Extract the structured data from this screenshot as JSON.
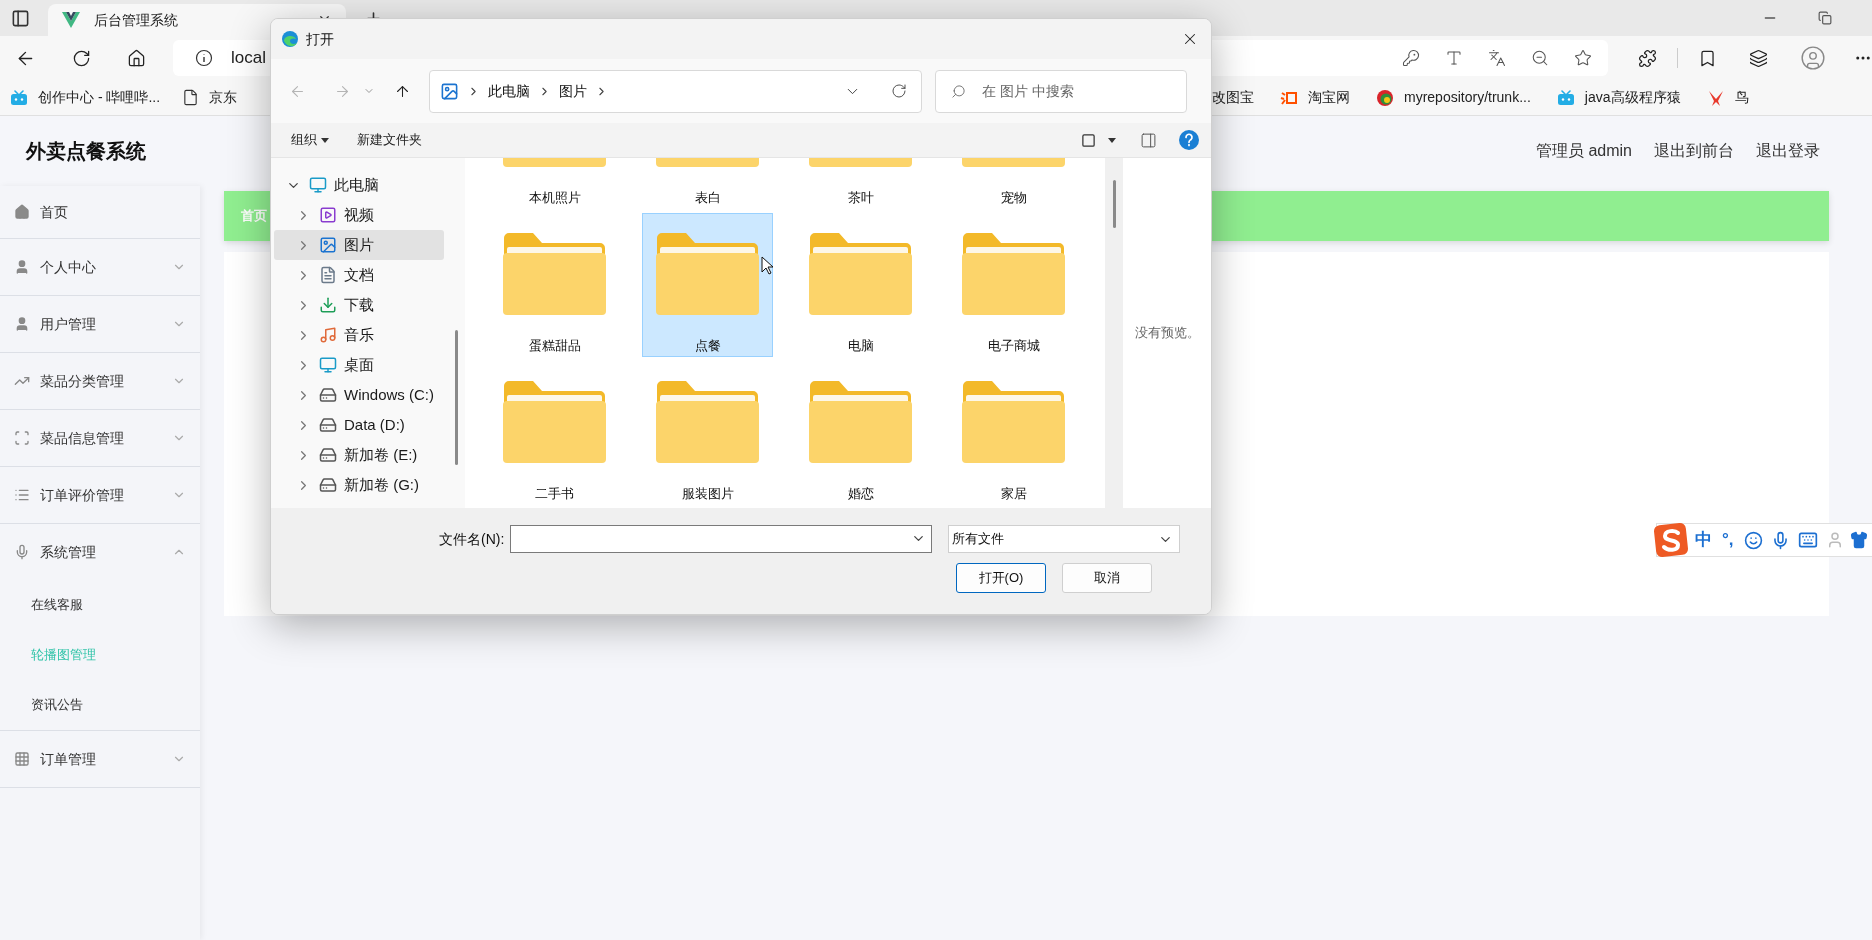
{
  "browser": {
    "tab": {
      "title": "后台管理系统"
    },
    "address": "local",
    "bookmarks_left": [
      {
        "label": "创作中心 - 哔哩哔..."
      },
      {
        "label": "京东"
      }
    ],
    "bookmarks_right": [
      {
        "label": "改图宝"
      },
      {
        "label": "淘宝网"
      },
      {
        "label": "myrepository/trunk..."
      },
      {
        "label": "java高级程序猿"
      },
      {
        "label": "鸟"
      }
    ]
  },
  "app": {
    "title": "外卖点餐系统",
    "header_links": [
      "管理员 admin",
      "退出到前台",
      "退出登录"
    ],
    "breadcrumb": "首页",
    "menu": [
      {
        "label": "首页"
      },
      {
        "label": "个人中心",
        "expanded": false
      },
      {
        "label": "用户管理",
        "expanded": false
      },
      {
        "label": "菜品分类管理",
        "expanded": false
      },
      {
        "label": "菜品信息管理",
        "expanded": false
      },
      {
        "label": "订单评价管理",
        "expanded": false
      },
      {
        "label": "系统管理",
        "expanded": true,
        "children": [
          {
            "label": "在线客服",
            "selected": false
          },
          {
            "label": "轮播图管理",
            "selected": true
          },
          {
            "label": "资讯公告",
            "selected": false
          }
        ]
      },
      {
        "label": "订单管理",
        "expanded": false
      }
    ]
  },
  "dialog": {
    "title": "打开",
    "nav": {
      "back": {
        "disabled": true
      },
      "forward": {
        "disabled": true
      },
      "up": {
        "disabled": false
      }
    },
    "path": [
      "此电脑",
      "图片"
    ],
    "search": {
      "placeholder": "在 图片 中搜索"
    },
    "toolbar": [
      "组织",
      "新建文件夹"
    ],
    "tree": [
      {
        "label": "此电脑",
        "expanded": true,
        "selected": false,
        "children": [
          {
            "label": "视频",
            "expanded": false,
            "selected": false
          },
          {
            "label": "图片",
            "expanded": false,
            "selected": true
          },
          {
            "label": "文档",
            "expanded": false,
            "selected": false
          },
          {
            "label": "下载",
            "expanded": false,
            "selected": false
          },
          {
            "label": "音乐",
            "expanded": false,
            "selected": false
          },
          {
            "label": "桌面",
            "expanded": false,
            "selected": false
          },
          {
            "label": "Windows (C:)",
            "expanded": false,
            "selected": false
          },
          {
            "label": "Data (D:)",
            "expanded": false,
            "selected": false
          },
          {
            "label": "新加卷 (E:)",
            "expanded": false,
            "selected": false
          },
          {
            "label": "新加卷 (G:)",
            "expanded": false,
            "selected": false
          }
        ]
      }
    ],
    "folders": [
      {
        "label": "本机照片",
        "selected": false
      },
      {
        "label": "表白",
        "selected": false
      },
      {
        "label": "茶叶",
        "selected": false
      },
      {
        "label": "宠物",
        "selected": false
      },
      {
        "label": "蛋糕甜品",
        "selected": false
      },
      {
        "label": "点餐",
        "selected": true
      },
      {
        "label": "电脑",
        "selected": false
      },
      {
        "label": "电子商城",
        "selected": false
      },
      {
        "label": "二手书",
        "selected": false
      },
      {
        "label": "服装图片",
        "selected": false
      },
      {
        "label": "婚恋",
        "selected": false
      },
      {
        "label": "家居",
        "selected": false
      }
    ],
    "preview": "没有预览。",
    "filename_label": "文件名(N):",
    "file_type": "所有文件",
    "buttons": [
      {
        "label": "打开(O)",
        "primary": true
      },
      {
        "label": "取消",
        "primary": false
      }
    ]
  },
  "ime": {
    "mode": "中",
    "punctuation": "°,"
  }
}
